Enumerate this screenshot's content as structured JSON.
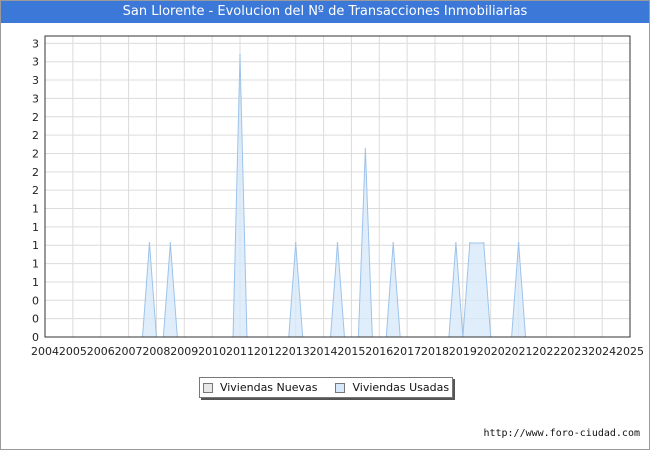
{
  "chart_data": {
    "type": "area",
    "title": "San Llorente - Evolucion del Nº de Transacciones Inmobiliarias",
    "xlabel": "",
    "ylabel": "",
    "x_ticks": [
      "2004",
      "2005",
      "2006",
      "2007",
      "2008",
      "2009",
      "2010",
      "2011",
      "2012",
      "2013",
      "2014",
      "2015",
      "2016",
      "2017",
      "2018",
      "2019",
      "2020",
      "2021",
      "2022",
      "2023",
      "2024",
      "2025"
    ],
    "y_tick_labels": [
      "0",
      "0",
      "0",
      "1",
      "1",
      "1",
      "1",
      "1",
      "2",
      "2",
      "2",
      "2",
      "2",
      "3",
      "3",
      "3",
      "3"
    ],
    "ylim": [
      0,
      3.2
    ],
    "grid": true,
    "legend_position": "bottom-center",
    "series": [
      {
        "name": "Viviendas Nuevas",
        "color": "#e8e8e8",
        "points": []
      },
      {
        "name": "Viviendas Usadas",
        "color": "#d6e8fa",
        "line_color": "#9dc3ea",
        "points": [
          {
            "x": 2007.5,
            "y": 0
          },
          {
            "x": 2007.75,
            "y": 1
          },
          {
            "x": 2008.0,
            "y": 0
          },
          {
            "x": 2008.25,
            "y": 0
          },
          {
            "x": 2008.5,
            "y": 1
          },
          {
            "x": 2008.75,
            "y": 0
          },
          {
            "x": 2010.75,
            "y": 0
          },
          {
            "x": 2011.0,
            "y": 3
          },
          {
            "x": 2011.25,
            "y": 0
          },
          {
            "x": 2012.75,
            "y": 0
          },
          {
            "x": 2013.0,
            "y": 1
          },
          {
            "x": 2013.25,
            "y": 0
          },
          {
            "x": 2014.25,
            "y": 0
          },
          {
            "x": 2014.5,
            "y": 1
          },
          {
            "x": 2014.75,
            "y": 0
          },
          {
            "x": 2015.25,
            "y": 0
          },
          {
            "x": 2015.5,
            "y": 2
          },
          {
            "x": 2015.75,
            "y": 0
          },
          {
            "x": 2016.25,
            "y": 0
          },
          {
            "x": 2016.5,
            "y": 1
          },
          {
            "x": 2016.75,
            "y": 0
          },
          {
            "x": 2018.5,
            "y": 0
          },
          {
            "x": 2018.75,
            "y": 1
          },
          {
            "x": 2019.0,
            "y": 0
          },
          {
            "x": 2019.25,
            "y": 1
          },
          {
            "x": 2019.75,
            "y": 1
          },
          {
            "x": 2020.0,
            "y": 0
          },
          {
            "x": 2020.75,
            "y": 0
          },
          {
            "x": 2021.0,
            "y": 1
          },
          {
            "x": 2021.25,
            "y": 0
          }
        ]
      }
    ]
  },
  "footer": {
    "url": "http://www.foro-ciudad.com"
  }
}
